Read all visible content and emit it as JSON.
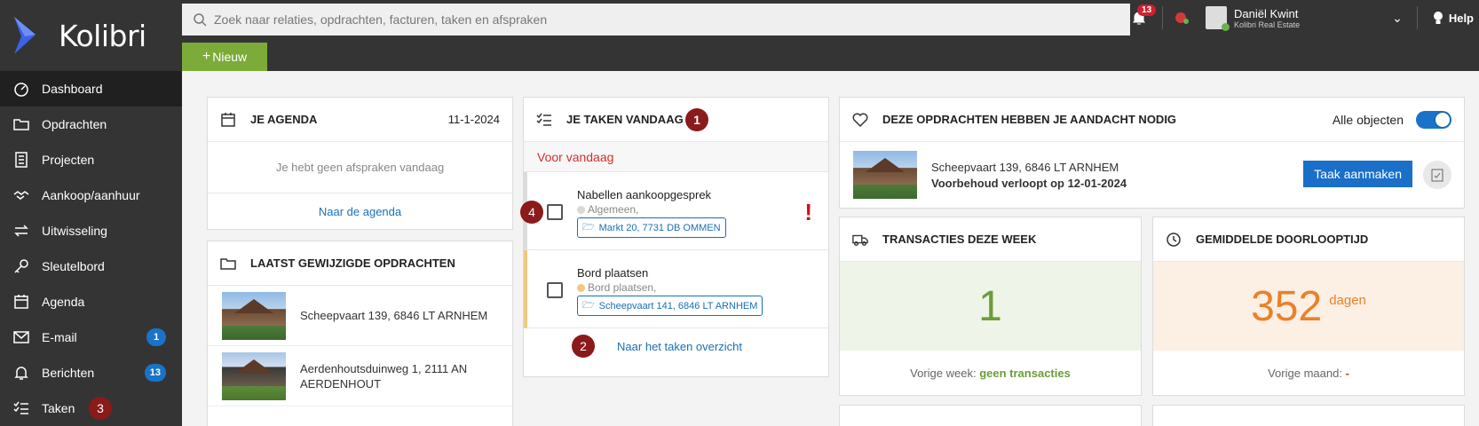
{
  "app": {
    "name": "Kolibri"
  },
  "search": {
    "placeholder": "Zoek naar relaties, opdrachten, facturen, taken en afspraken"
  },
  "topbar": {
    "new_label": "Nieuw",
    "notifications_count": "13",
    "user_name": "Daniël Kwint",
    "user_company": "Kolibri Real Estate",
    "help_label": "Help"
  },
  "sidebar": {
    "items": [
      {
        "label": "Dashboard",
        "icon": "dashboard-icon"
      },
      {
        "label": "Opdrachten",
        "icon": "folder-icon"
      },
      {
        "label": "Projecten",
        "icon": "building-icon"
      },
      {
        "label": "Aankoop/aanhuur",
        "icon": "handshake-icon"
      },
      {
        "label": "Uitwisseling",
        "icon": "exchange-icon"
      },
      {
        "label": "Sleutelbord",
        "icon": "key-icon"
      },
      {
        "label": "Agenda",
        "icon": "calendar-icon"
      },
      {
        "label": "E-mail",
        "icon": "mail-icon",
        "badge": "1"
      },
      {
        "label": "Berichten",
        "icon": "bell-icon",
        "badge": "13"
      },
      {
        "label": "Taken",
        "icon": "tasks-icon"
      }
    ]
  },
  "markers": {
    "m1": "1",
    "m2": "2",
    "m3": "3",
    "m4": "4"
  },
  "agenda": {
    "title": "JE AGENDA",
    "date": "11-1-2024",
    "empty": "Je hebt geen afspraken vandaag",
    "link": "Naar de agenda"
  },
  "recent": {
    "title": "LAATST GEWIJZIGDE OPDRACHTEN",
    "items": [
      {
        "address": "Scheepvaart 139, 6846 LT ARNHEM"
      },
      {
        "address": "Aerdenhoutsduinweg 1, 2111 AN AERDENHOUT"
      }
    ]
  },
  "tasks": {
    "title": "JE TAKEN VANDAAG",
    "section": "Voor vandaag",
    "link": "Naar het taken overzicht",
    "items": [
      {
        "title": "Nabellen aankoopgesprek",
        "category": "Algemeen,",
        "tag": "Markt 20, 7731 DB OMMEN",
        "urgent": "!"
      },
      {
        "title": "Bord plaatsen",
        "category": "Bord plaatsen,",
        "tag": "Scheepvaart 141, 6846 LT ARNHEM"
      }
    ]
  },
  "attention": {
    "title": "DEZE OPDRACHTEN HEBBEN JE AANDACHT NODIG",
    "toggle_label": "Alle objecten",
    "address": "Scheepvaart 139, 6846 LT ARNHEM",
    "notice": "Voorbehoud verloopt op 12-01-2024",
    "button": "Taak aanmaken"
  },
  "transactions": {
    "title": "TRANSACTIES DEZE WEEK",
    "value": "1",
    "footer_label": "Vorige week:",
    "footer_value": "geen transacties"
  },
  "lead_time": {
    "title": "GEMIDDELDE DOORLOOPTIJD",
    "value": "352",
    "unit": "dagen",
    "footer_label": "Vorige maand:",
    "footer_value": "-"
  },
  "colors": {
    "accent_green": "#7cab3a",
    "accent_blue": "#1a6fc8",
    "marker": "#8b1a1a",
    "transaction_bg": "#eef4e8",
    "leadtime_bg": "#fcefe4"
  }
}
